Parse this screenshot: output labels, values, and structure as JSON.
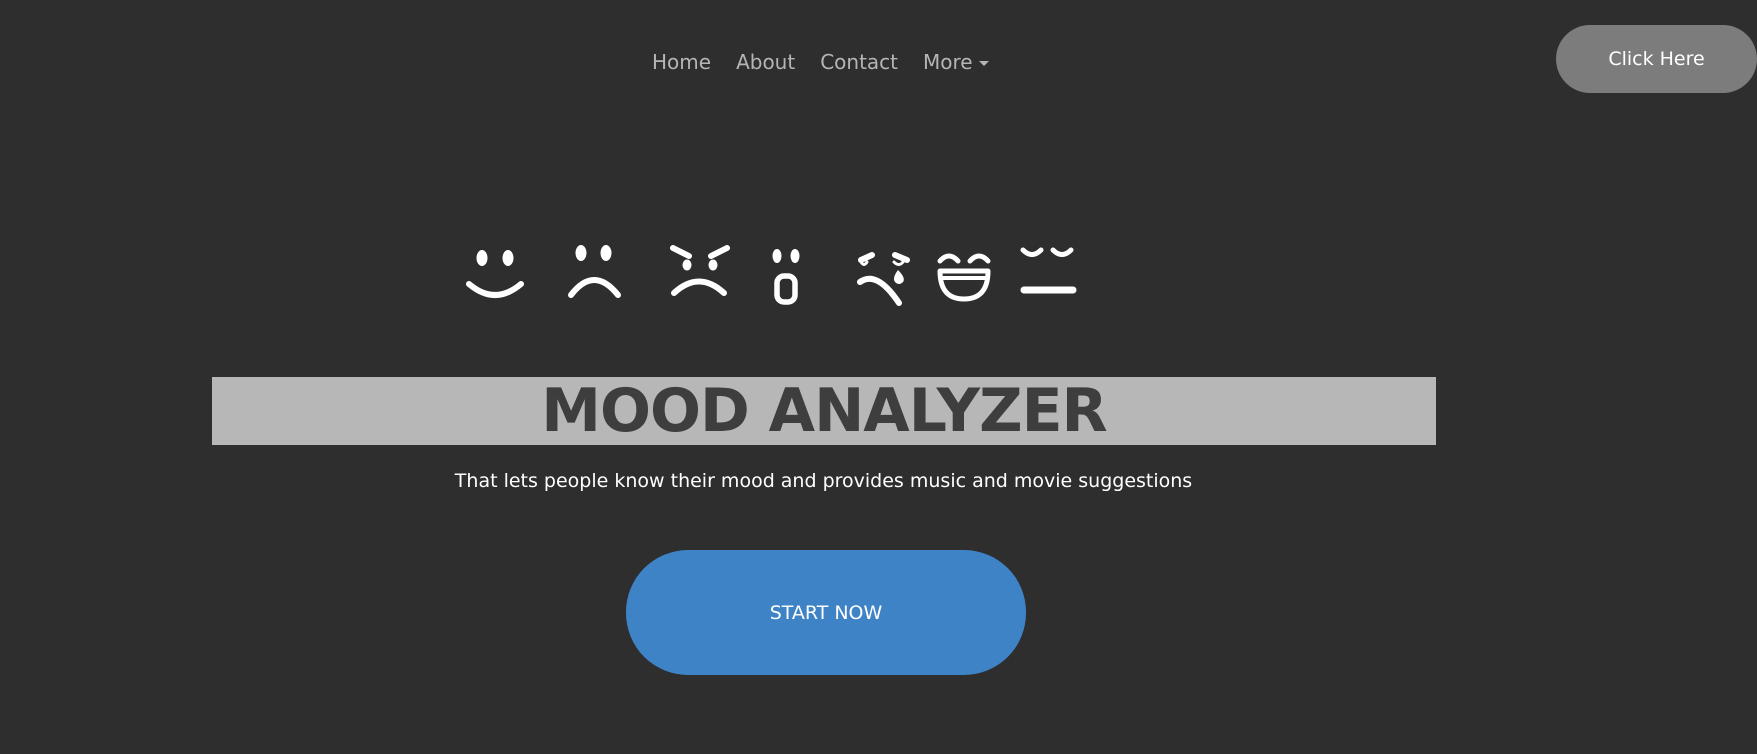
{
  "nav": {
    "items": [
      {
        "label": "Home"
      },
      {
        "label": "About"
      },
      {
        "label": "Contact"
      },
      {
        "label": "More"
      }
    ],
    "more_icon": "caret-down-icon"
  },
  "header_button": {
    "label": "Click Here"
  },
  "emojis": [
    {
      "icon": "smile-face-icon",
      "mood": "happy"
    },
    {
      "icon": "sad-face-icon",
      "mood": "sad"
    },
    {
      "icon": "angry-face-icon",
      "mood": "angry"
    },
    {
      "icon": "surprised-face-icon",
      "mood": "surprised"
    },
    {
      "icon": "crying-face-icon",
      "mood": "crying"
    },
    {
      "icon": "grinning-face-icon",
      "mood": "laughing"
    },
    {
      "icon": "neutral-face-icon",
      "mood": "calm"
    }
  ],
  "hero": {
    "title": "MOOD ANALYZER",
    "subtitle": "That lets people know their mood and provides music and movie suggestions",
    "cta_label": "START NOW"
  },
  "colors": {
    "background": "#2e2e2e",
    "nav_text": "#b5b5b5",
    "header_button_bg": "#7c7c7c",
    "title_band_bg": "#b7b7b7",
    "title_text": "#3e3e3e",
    "cta_bg": "#3e83c6",
    "icon_fill": "#ffffff"
  }
}
